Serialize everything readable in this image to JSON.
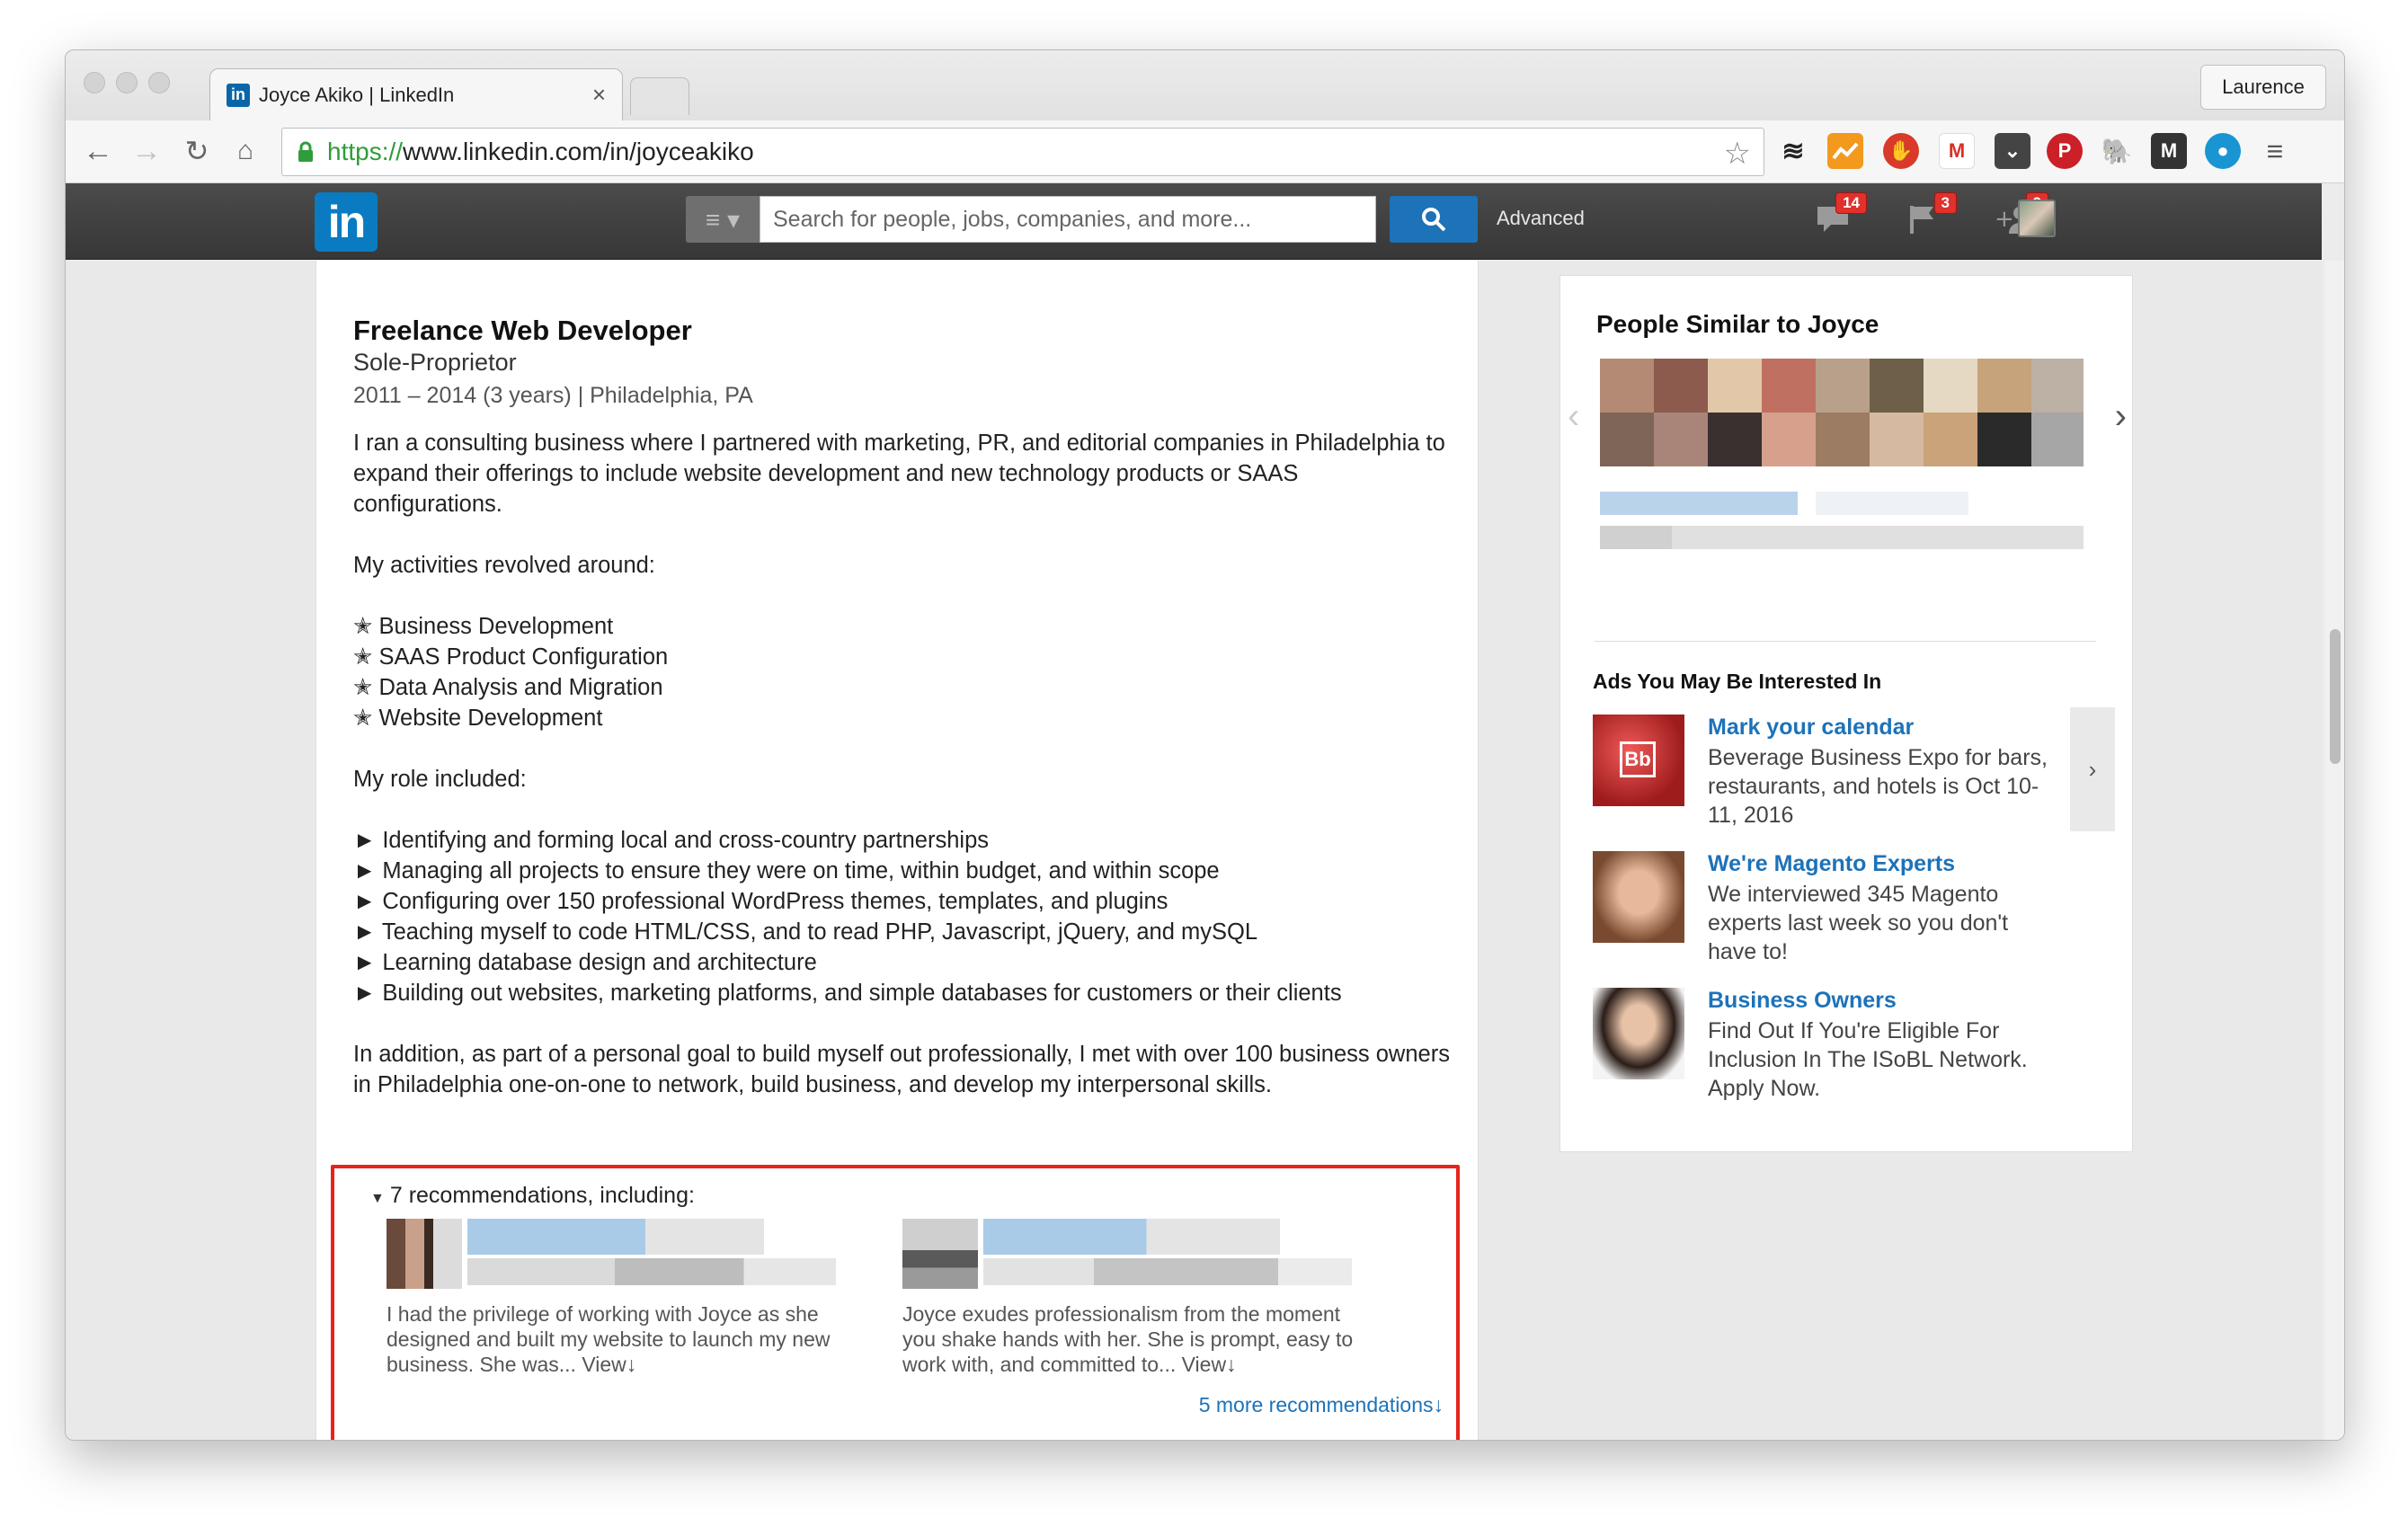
{
  "browser": {
    "tab_title": "Joyce Akiko | LinkedIn",
    "tab_favicon": "in",
    "profile_name": "Laurence",
    "url_scheme": "https://",
    "url_rest": "www.linkedin.com/in/joyceakiko"
  },
  "linkedin": {
    "logo": "in",
    "search_placeholder": "Search for people, jobs, companies, and more...",
    "advanced_label": "Advanced",
    "messages_count": "14",
    "notifications_count": "3",
    "invites_count": "2"
  },
  "position": {
    "title": "Freelance Web Developer",
    "company": "Sole-Proprietor",
    "dates": "2011 – 2014 (3 years)  |  Philadelphia, PA",
    "intro": "I ran a consulting business where I partnered with marketing, PR, and editorial companies in Philadelphia to expand their offerings to include website development and new technology products or SAAS configurations.",
    "activities_heading": "My activities revolved around:",
    "activities": [
      "✭ Business Development",
      "✭ SAAS Product Configuration",
      "✭ Data Analysis and Migration",
      "✭ Website Development"
    ],
    "role_heading": "My role included:",
    "role_items": [
      "► Identifying and forming local and cross-country partnerships",
      "► Managing all projects to ensure they were on time, within budget, and within scope",
      "► Configuring over 150 professional WordPress themes, templates, and plugins",
      "► Teaching myself to code HTML/CSS, and to read PHP, Javascript, jQuery, and mySQL",
      "► Learning database design and architecture",
      "► Building out websites, marketing platforms, and simple databases for customers or their clients"
    ],
    "closing": "In addition, as part of a personal goal to build myself out professionally, I met with over 100 business owners in Philadelphia one-on-one to network, build business, and develop my interpersonal skills."
  },
  "recommendations": {
    "heading": "7 recommendations, including:",
    "items": [
      {
        "text": "I had the privilege of working with Joyce as she designed and built my website to launch my new business. She was... ",
        "view": "View↓"
      },
      {
        "text": "Joyce exudes professionalism from the moment you shake hands with her. She is prompt, easy to work with, and committed to... ",
        "view": "View↓"
      }
    ],
    "more": "5 more recommendations↓"
  },
  "sidebar": {
    "similar_title": "People Similar to Joyce",
    "ads_title": "Ads You May Be Interested In",
    "ads": [
      {
        "headline": "Mark your calendar",
        "body": "Beverage Business Expo for bars, restaurants, and hotels is Oct 10-11, 2016"
      },
      {
        "headline": "We're Magento Experts",
        "body": "We interviewed 345 Magento experts last week so you don't have to!"
      },
      {
        "headline": "Business Owners",
        "body": "Find Out If You're Eligible For Inclusion In The ISoBL Network. Apply Now."
      }
    ]
  }
}
